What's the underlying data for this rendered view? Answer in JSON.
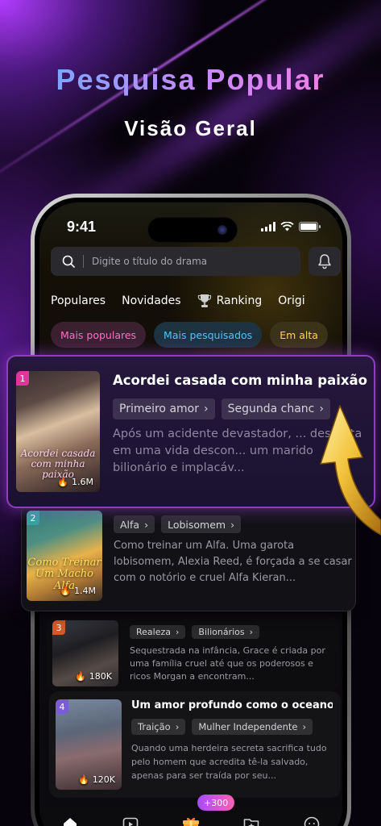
{
  "promo": {
    "headline": "Pesquisa Popular",
    "subheadline": "Visão Geral"
  },
  "status_bar": {
    "time": "9:41"
  },
  "search": {
    "placeholder": "Digite o título do drama"
  },
  "tabs": [
    {
      "label": "Populares"
    },
    {
      "label": "Novidades"
    },
    {
      "label": "Ranking",
      "icon": "trophy-icon"
    },
    {
      "label": "Origi"
    }
  ],
  "chips": [
    {
      "label": "Mais populares",
      "color": "#ff6ec7"
    },
    {
      "label": "Mais pesquisados",
      "color": "#4fc4ff"
    },
    {
      "label": "Em alta",
      "color": "#ffd54a"
    }
  ],
  "dramas": [
    {
      "rank": "1",
      "title": "Acordei casada com minha paixão",
      "tags": [
        "Primeiro amor",
        "Segunda chanc"
      ],
      "description": "Após um acidente devastador, ... desperta em uma vida descon... um marido bilionário e implacáv...",
      "views": "1.6M",
      "cover_text": "Acordei casada com minha paixão"
    },
    {
      "rank": "2",
      "title": "",
      "tags": [
        "Alfa",
        "Lobisomem"
      ],
      "description": "Como treinar um Alfa. Uma garota lobisomem, Alexia Reed, é forçada a se casar com o notório e cruel Alfa Kieran...",
      "views": "1.4M",
      "cover_text": "Como Treinar Um Macho Alfa"
    },
    {
      "rank": "3",
      "title": "",
      "tags": [
        "Realeza",
        "Bilionários"
      ],
      "description": "Sequestrada na infância, Grace é criada por uma família cruel até que os poderosos e ricos Morgan a encontram...",
      "views": "180K",
      "cover_text": ""
    },
    {
      "rank": "4",
      "title": "Um amor profundo como o oceano",
      "tags": [
        "Traição",
        "Mulher Independente"
      ],
      "description": "Quando uma herdeira secreta sacrifica tudo pelo homem que acredita tê-la salvado, apenas para ser traída por seu...",
      "views": "120K",
      "cover_text": ""
    }
  ],
  "tabbar": {
    "items": [
      "home-icon",
      "play-icon",
      "gift-icon",
      "folder-star-icon",
      "profile-icon"
    ],
    "bonus_badge": "+300"
  }
}
